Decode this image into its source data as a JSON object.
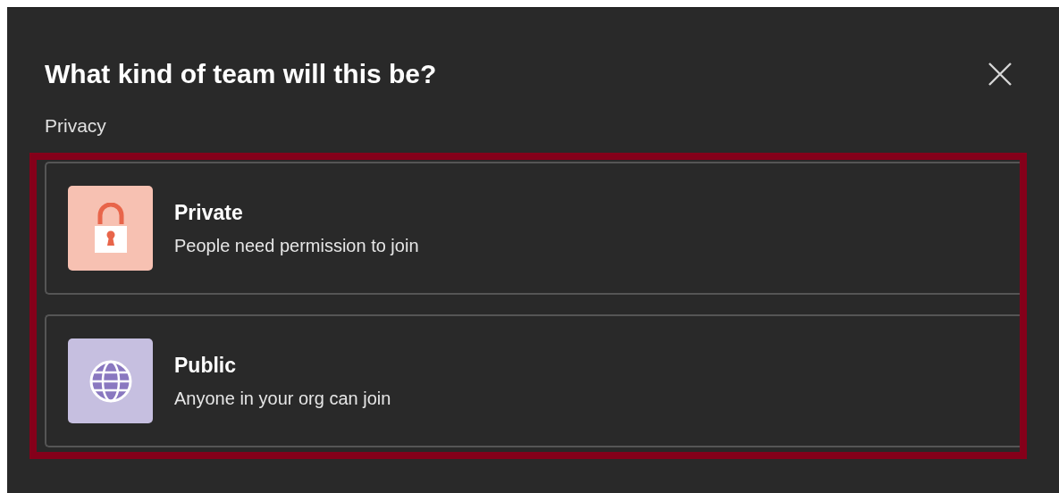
{
  "dialog": {
    "title": "What kind of team will this be?",
    "section_label": "Privacy"
  },
  "options": [
    {
      "kind": "private",
      "title": "Private",
      "description": "People need permission to join"
    },
    {
      "kind": "public",
      "title": "Public",
      "description": "Anyone in your org can join"
    }
  ]
}
